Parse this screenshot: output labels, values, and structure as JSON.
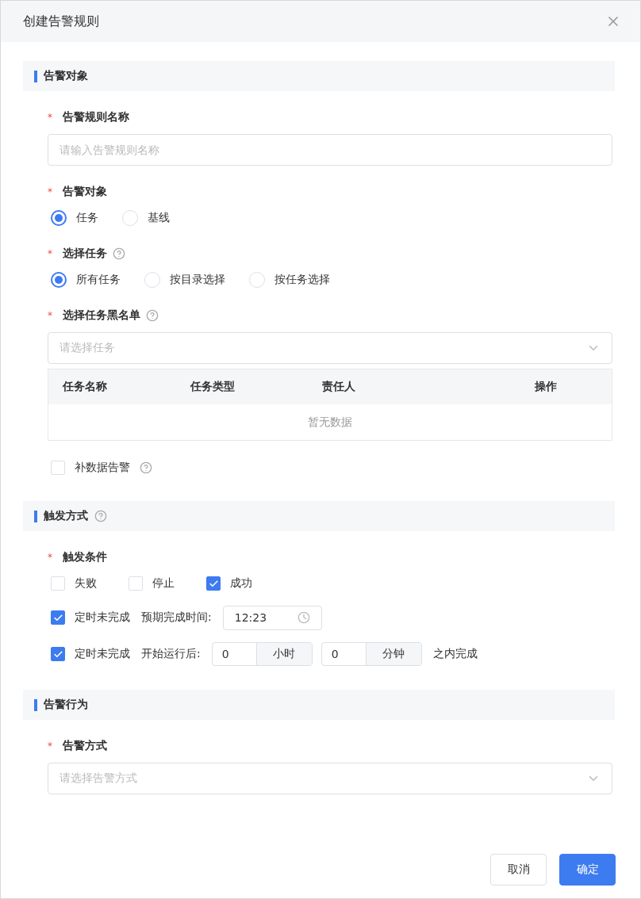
{
  "dialog": {
    "title": "创建告警规则"
  },
  "sections": [
    {
      "title": "告警对象",
      "fields": [
        {
          "kind": "input",
          "label": "告警规则名称",
          "required_mark": "*",
          "placeholder": "请输入告警规则名称"
        },
        {
          "kind": "radio",
          "label": "告警对象",
          "required_mark": "*",
          "options": [
            {
              "label": "任务",
              "selected": true
            },
            {
              "label": "基线",
              "selected": false
            }
          ]
        },
        {
          "kind": "radio",
          "label": "选择任务",
          "required_mark": "*",
          "help": true,
          "options": [
            {
              "label": "所有任务",
              "selected": true
            },
            {
              "label": "按目录选择",
              "selected": false
            },
            {
              "label": "按任务选择",
              "selected": false
            }
          ]
        },
        {
          "kind": "select",
          "label": "选择任务黑名单",
          "required_mark": "*",
          "help": true,
          "placeholder": "请选择任务",
          "table": {
            "columns": [
              "任务名称",
              "任务类型",
              "责任人",
              "操作"
            ],
            "empty": "暂无数据"
          }
        },
        {
          "kind": "checkbox",
          "text": "补数据告警",
          "checked": false,
          "help": true
        }
      ]
    },
    {
      "title": "触发方式",
      "help": true,
      "fields": [
        {
          "kind": "conditions",
          "label": "触发条件",
          "required_mark": "*",
          "options": [
            {
              "label": "失败",
              "checked": false
            },
            {
              "label": "停止",
              "checked": false
            },
            {
              "label": "成功",
              "checked": true
            }
          ],
          "rows": [
            {
              "kind": "time",
              "checked": true,
              "label": "定时未完成",
              "prompt": "预期完成时间:",
              "value": "12:23"
            },
            {
              "kind": "duration",
              "checked": true,
              "label": "定时未完成",
              "prompt": "开始运行后:",
              "hours": "0",
              "hours_unit": "小时",
              "minutes": "0",
              "minutes_unit": "分钟",
              "suffix": "之内完成"
            }
          ]
        }
      ]
    },
    {
      "title": "告警行为",
      "fields": [
        {
          "kind": "select",
          "label": "告警方式",
          "required_mark": "*",
          "placeholder": "请选择告警方式"
        }
      ]
    }
  ],
  "buttons": [
    {
      "label": "取消",
      "kind": "default"
    },
    {
      "label": "确定",
      "kind": "primary"
    }
  ]
}
